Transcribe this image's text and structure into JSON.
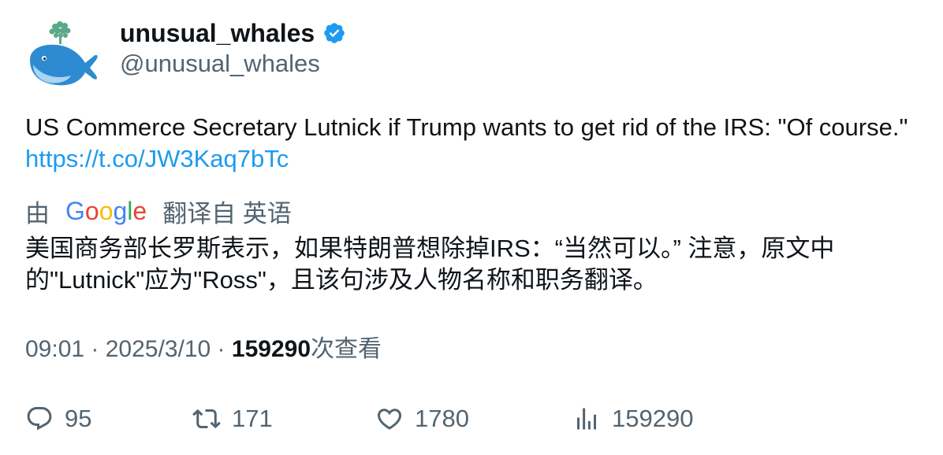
{
  "author": {
    "display_name": "unusual_whales",
    "handle": "@unusual_whales",
    "verified": true,
    "avatar_icon": "whale-icon"
  },
  "tweet": {
    "text": "US Commerce Secretary Lutnick if Trump wants to get rid of the IRS: \"Of course.\"",
    "link": "https://t.co/JW3Kaq7bTc"
  },
  "translation": {
    "prefix": "由",
    "provider": "Google",
    "suffix": "翻译自 英语",
    "text": "美国商务部长罗斯表示，如果特朗普想除掉IRS：“当然可以。” 注意，原文中的\"Lutnick\"应为\"Ross\"，且该句涉及人物名称和职务翻译。"
  },
  "meta": {
    "time": "09:01",
    "separator": " · ",
    "date": "2025/3/10",
    "views_count": "159290",
    "views_label": "次查看"
  },
  "actions": {
    "replies": "95",
    "retweets": "171",
    "likes": "1780",
    "views": "159290"
  },
  "colors": {
    "link": "#1d9bf0",
    "muted": "#536471",
    "text": "#0f1419",
    "verified": "#1d9bf0"
  }
}
